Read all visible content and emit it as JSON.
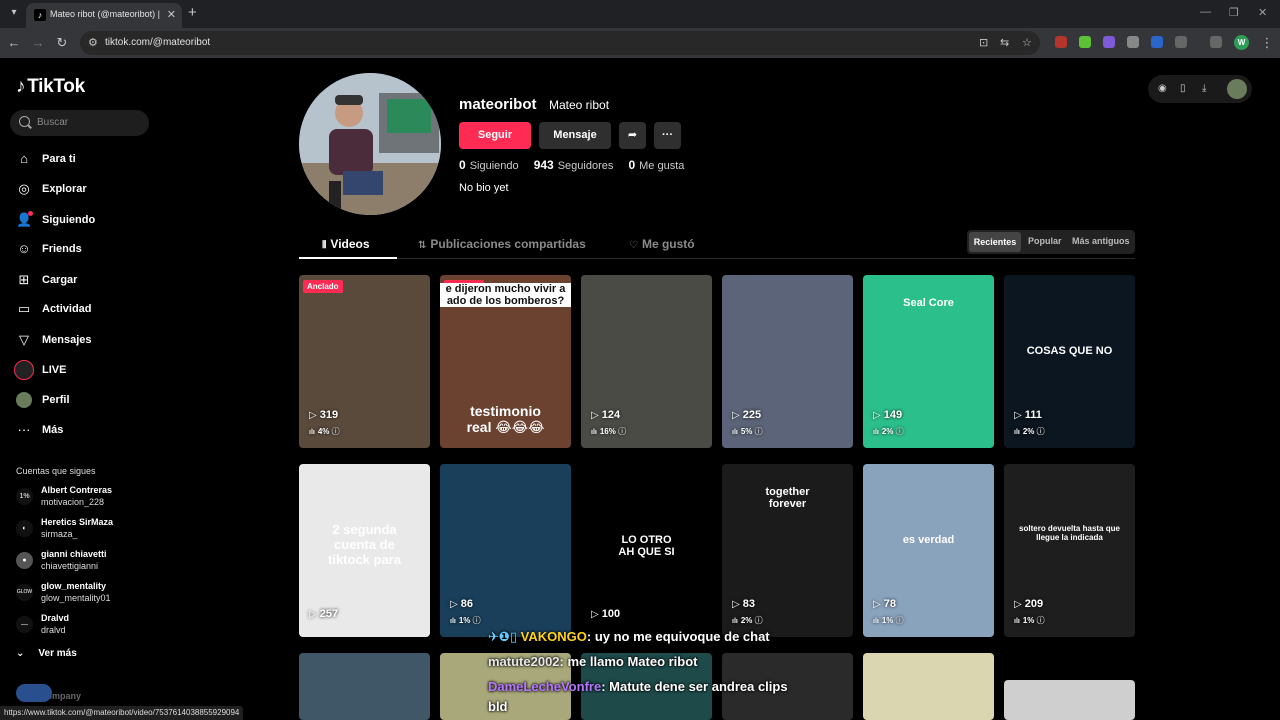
{
  "browser": {
    "tab_title": "Mateo ribot (@mateoribot) | TikTok",
    "url": "tiktok.com/@mateoribot",
    "status_url": "https://www.tiktok.com/@mateoribot/video/7537614038855929094",
    "profile_initial": "W"
  },
  "sidebar": {
    "logo": "TikTok",
    "search_placeholder": "Buscar",
    "items": [
      {
        "label": "Para ti",
        "icon": "home-icon"
      },
      {
        "label": "Explorar",
        "icon": "compass-icon"
      },
      {
        "label": "Siguiendo",
        "icon": "following-icon"
      },
      {
        "label": "Friends",
        "icon": "friends-icon"
      },
      {
        "label": "Cargar",
        "icon": "upload-icon"
      },
      {
        "label": "Actividad",
        "icon": "activity-icon"
      },
      {
        "label": "Mensajes",
        "icon": "messages-icon"
      },
      {
        "label": "LIVE",
        "icon": "live-icon"
      },
      {
        "label": "Perfil",
        "icon": "profile-icon"
      },
      {
        "label": "Más",
        "icon": "more-icon"
      }
    ],
    "following_header": "Cuentas que sigues",
    "following": [
      {
        "name": "Albert Contreras",
        "user": "motivacion_228",
        "av": "1%"
      },
      {
        "name": "Heretics SirMaza",
        "user": "sirmaza_",
        "av": "◐"
      },
      {
        "name": "gianni chiavetti",
        "user": "chiavettigianni",
        "av": "●"
      },
      {
        "name": "glow_mentality",
        "user": "glow_mentality01",
        "av": "GLOW"
      },
      {
        "name": "Dralvd",
        "user": "dralvd",
        "av": "—"
      }
    ],
    "see_more": "Ver más",
    "company": "Company"
  },
  "profile": {
    "username": "mateoribot",
    "nickname": "Mateo ribot",
    "follow_label": "Seguir",
    "message_label": "Mensaje",
    "following_count": "0",
    "following_label": "Siguiendo",
    "followers_count": "943",
    "followers_label": "Seguidores",
    "likes_count": "0",
    "likes_label": "Me gusta",
    "bio": "No bio yet"
  },
  "tabs": {
    "videos": "Videos",
    "reposts": "Publicaciones compartidas",
    "liked": "Me gustó"
  },
  "sort": {
    "recent": "Recientes",
    "popular": "Popular",
    "oldest": "Más antiguos"
  },
  "videos": [
    {
      "views": "319",
      "pct": "4%",
      "pinned": "Anclado",
      "bg": "#5a4a3c"
    },
    {
      "views": "",
      "pct": "",
      "pinned": "Anclado",
      "bg": "#6b4230",
      "overlay_top": "e dijeron mucho vivir a\nado de los bomberos?",
      "overlay_mid": "testimonio\nreal 😂😂😂"
    },
    {
      "views": "124",
      "pct": "16%",
      "pinned": "",
      "bg": "#4b4b46"
    },
    {
      "views": "225",
      "pct": "5%",
      "pinned": "",
      "bg": "#5b6478"
    },
    {
      "views": "149",
      "pct": "2%",
      "pinned": "",
      "bg": "#2bbf8c",
      "overlay_top": "Seal Core"
    },
    {
      "views": "111",
      "pct": "2%",
      "pinned": "",
      "bg": "#0c1620",
      "overlay_mid": "COSAS QUE NO"
    },
    {
      "views": "257",
      "pct": "",
      "pinned": "",
      "bg": "#e9e9e9",
      "overlay_mid": "2 segunda\ncuenta de\ntiktock para"
    },
    {
      "views": "86",
      "pct": "1%",
      "pinned": "",
      "bg": "#1a3f5a"
    },
    {
      "views": "100",
      "pct": "",
      "pinned": "",
      "bg": "#000000",
      "overlay_mid": "LO OTRO\nAH QUE SI"
    },
    {
      "views": "83",
      "pct": "2%",
      "pinned": "",
      "bg": "#1b1b1b",
      "overlay_top": "together\nforever"
    },
    {
      "views": "78",
      "pct": "1%",
      "pinned": "",
      "bg": "#8aa3bd",
      "overlay_mid": "es verdad"
    },
    {
      "views": "209",
      "pct": "1%",
      "pinned": "",
      "bg": "#1e1e1e",
      "overlay_mid": "soltero devuelta hasta que\nllegue la indicada"
    }
  ],
  "chat": [
    {
      "name": "VAKONGO",
      "msg": ": uy no me equivoque de chat",
      "color": "yellow"
    },
    {
      "name": "matute2002",
      "msg": ": me llamo Mateo ribot",
      "color": "light"
    },
    {
      "name": "DameLecheVonfre",
      "msg": ": Matute dene ser andrea clips",
      "color": "purple"
    },
    {
      "name": "",
      "msg": "bld",
      "color": "light"
    }
  ]
}
